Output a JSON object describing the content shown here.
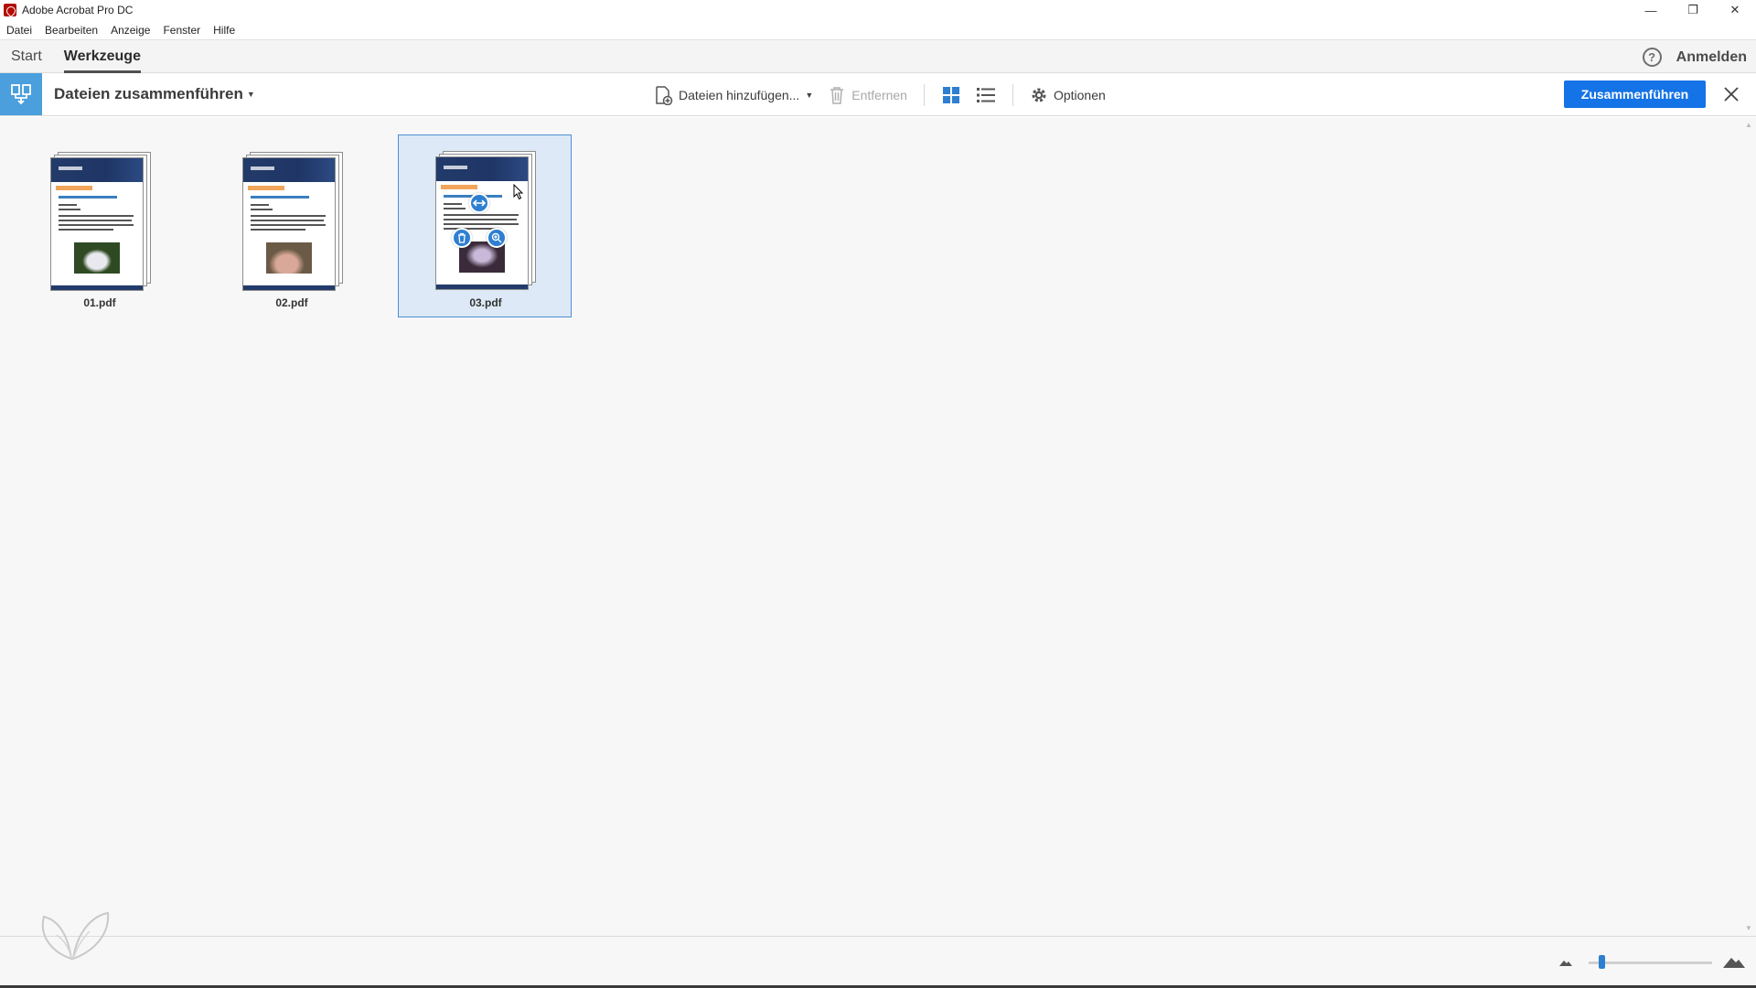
{
  "window": {
    "title": "Adobe Acrobat Pro DC",
    "minimize": "—",
    "restore": "❐",
    "close": "✕"
  },
  "menu": [
    "Datei",
    "Bearbeiten",
    "Anzeige",
    "Fenster",
    "Hilfe"
  ],
  "tabs": {
    "start": "Start",
    "tools": "Werkzeuge",
    "help": "?",
    "signin": "Anmelden"
  },
  "toolbar": {
    "tool_name": "Dateien zusammenführen",
    "add_files": "Dateien hinzufügen...",
    "remove": "Entfernen",
    "options": "Optionen",
    "combine": "Zusammenführen"
  },
  "files": [
    {
      "name": "01.pdf",
      "selected": false,
      "photo_colors": [
        "#2f4a22",
        "#e8e8ee"
      ]
    },
    {
      "name": "02.pdf",
      "selected": false,
      "photo_colors": [
        "#6a5a46",
        "#d9a898"
      ]
    },
    {
      "name": "03.pdf",
      "selected": true,
      "photo_colors": [
        "#3a2a3a",
        "#c9b8d8"
      ]
    }
  ],
  "colors": {
    "accent": "#1473e6",
    "selection": "#dde9f6",
    "tool_badge": "#4a9fdc"
  },
  "zoom": {
    "level": 0.1
  }
}
